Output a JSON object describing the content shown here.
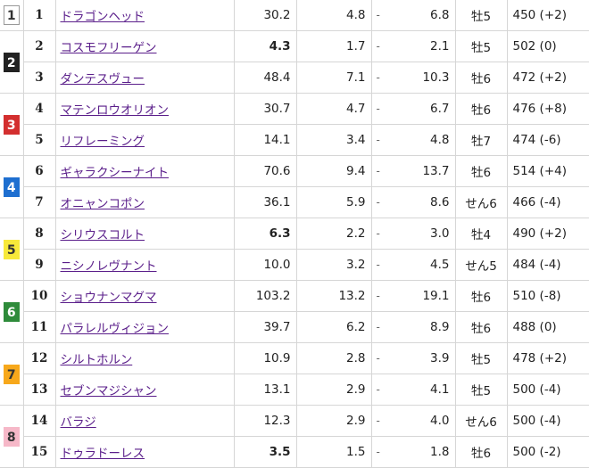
{
  "horses": [
    {
      "waku": "1",
      "num": "1",
      "name": "ドラゴンヘッド",
      "odds": "30.2",
      "popular": false,
      "low": "4.8",
      "high": "6.8",
      "sexage": "牡5",
      "weight": "450 (+2)"
    },
    {
      "waku": "2",
      "num": "2",
      "name": "コスモフリーゲン",
      "odds": "4.3",
      "popular": true,
      "low": "1.7",
      "high": "2.1",
      "sexage": "牡5",
      "weight": "502 (0)"
    },
    {
      "waku": "",
      "num": "3",
      "name": "ダンテスヴュー",
      "odds": "48.4",
      "popular": false,
      "low": "7.1",
      "high": "10.3",
      "sexage": "牡6",
      "weight": "472 (+2)"
    },
    {
      "waku": "3",
      "num": "4",
      "name": "マテンロウオリオン",
      "odds": "30.7",
      "popular": false,
      "low": "4.7",
      "high": "6.7",
      "sexage": "牡6",
      "weight": "476 (+8)"
    },
    {
      "waku": "",
      "num": "5",
      "name": "リフレーミング",
      "odds": "14.1",
      "popular": false,
      "low": "3.4",
      "high": "4.8",
      "sexage": "牡7",
      "weight": "474 (-6)"
    },
    {
      "waku": "4",
      "num": "6",
      "name": "ギャラクシーナイト",
      "odds": "70.6",
      "popular": false,
      "low": "9.4",
      "high": "13.7",
      "sexage": "牡6",
      "weight": "514 (+4)"
    },
    {
      "waku": "",
      "num": "7",
      "name": "オニャンコポン",
      "odds": "36.1",
      "popular": false,
      "low": "5.9",
      "high": "8.6",
      "sexage": "せん6",
      "weight": "466 (-4)"
    },
    {
      "waku": "5",
      "num": "8",
      "name": "シリウスコルト",
      "odds": "6.3",
      "popular": true,
      "low": "2.2",
      "high": "3.0",
      "sexage": "牡4",
      "weight": "490 (+2)"
    },
    {
      "waku": "",
      "num": "9",
      "name": "ニシノレヴナント",
      "odds": "10.0",
      "popular": false,
      "low": "3.2",
      "high": "4.5",
      "sexage": "せん5",
      "weight": "484 (-4)"
    },
    {
      "waku": "6",
      "num": "10",
      "name": "ショウナンマグマ",
      "odds": "103.2",
      "popular": false,
      "low": "13.2",
      "high": "19.1",
      "sexage": "牡6",
      "weight": "510 (-8)"
    },
    {
      "waku": "",
      "num": "11",
      "name": "パラレルヴィジョン",
      "odds": "39.7",
      "popular": false,
      "low": "6.2",
      "high": "8.9",
      "sexage": "牡6",
      "weight": "488 (0)"
    },
    {
      "waku": "7",
      "num": "12",
      "name": "シルトホルン",
      "odds": "10.9",
      "popular": false,
      "low": "2.8",
      "high": "3.9",
      "sexage": "牡5",
      "weight": "478 (+2)"
    },
    {
      "waku": "",
      "num": "13",
      "name": "セブンマジシャン",
      "odds": "13.1",
      "popular": false,
      "low": "2.9",
      "high": "4.1",
      "sexage": "牡5",
      "weight": "500 (-4)"
    },
    {
      "waku": "8",
      "num": "14",
      "name": "バラジ",
      "odds": "12.3",
      "popular": false,
      "low": "2.9",
      "high": "4.0",
      "sexage": "せん6",
      "weight": "500 (-4)"
    },
    {
      "waku": "",
      "num": "15",
      "name": "ドゥラドーレス",
      "odds": "3.5",
      "popular": true,
      "low": "1.5",
      "high": "1.8",
      "sexage": "牡6",
      "weight": "500 (-2)"
    }
  ],
  "range_separator": "-",
  "waku_colors": {
    "1": {
      "bg": "#ffffff",
      "fg": "#333333",
      "border": "#999999"
    },
    "2": {
      "bg": "#222222",
      "fg": "#ffffff",
      "border": "#222222"
    },
    "3": {
      "bg": "#d32f2f",
      "fg": "#ffffff",
      "border": "#d32f2f"
    },
    "4": {
      "bg": "#1e6fd0",
      "fg": "#ffffff",
      "border": "#1e6fd0"
    },
    "5": {
      "bg": "#f7e93a",
      "fg": "#333333",
      "border": "#f7e93a"
    },
    "6": {
      "bg": "#2e8b3a",
      "fg": "#ffffff",
      "border": "#2e8b3a"
    },
    "7": {
      "bg": "#f7a81b",
      "fg": "#333333",
      "border": "#f7a81b"
    },
    "8": {
      "bg": "#f6b8c8",
      "fg": "#333333",
      "border": "#f6b8c8"
    }
  },
  "colors": {
    "link": "#5a1e8a",
    "popular_odds": "#c4002c",
    "grid": "#d6d6d6"
  }
}
